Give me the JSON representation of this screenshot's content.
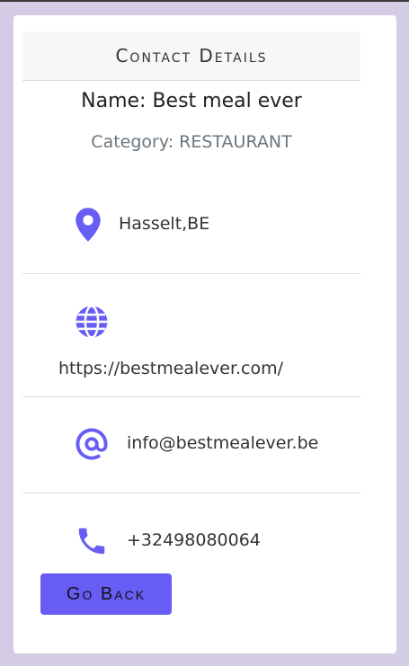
{
  "card": {
    "header_title": "Contact Details",
    "name_line": "Name: Best meal ever",
    "category_line": "Category: RESTAURANT"
  },
  "contact": {
    "location": "Hasselt,BE",
    "website": "https://bestmealever.com/",
    "email": "info@bestmealever.be",
    "phone": "+32498080064"
  },
  "icons": {
    "location": "map-pin-icon",
    "website": "globe-icon",
    "email": "at-sign-icon",
    "phone": "phone-icon"
  },
  "actions": {
    "back_label": "Go Back"
  },
  "colors": {
    "background": "#d4cce4",
    "accent": "#675df5",
    "card": "#ffffff"
  }
}
